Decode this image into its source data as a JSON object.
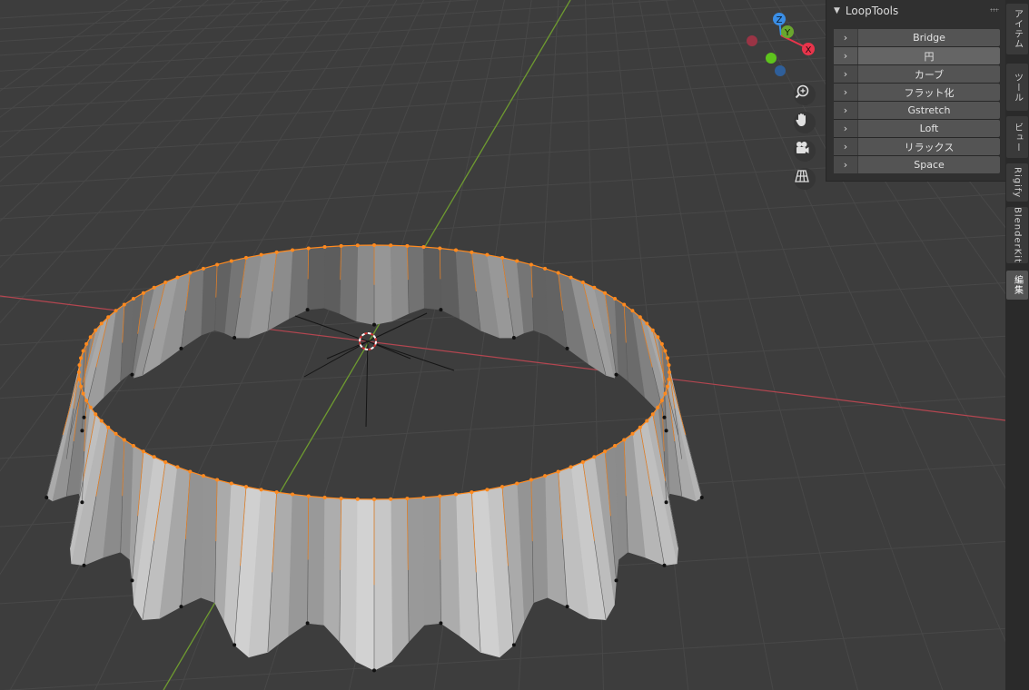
{
  "panel": {
    "title": "LoopTools",
    "operators": [
      {
        "label": "Bridge"
      },
      {
        "label": "円"
      },
      {
        "label": "カーブ"
      },
      {
        "label": "フラット化"
      },
      {
        "label": "Gstretch"
      },
      {
        "label": "Loft"
      },
      {
        "label": "リラックス"
      },
      {
        "label": "Space"
      }
    ],
    "hovered_index": 1
  },
  "tabs": [
    {
      "label": "アイテム"
    },
    {
      "label": "ツール"
    },
    {
      "label": "ビュー"
    },
    {
      "label": "Rigify"
    },
    {
      "label": "BlenderKit"
    },
    {
      "label": "編集"
    }
  ],
  "active_tab_index": 5,
  "gizmo": {
    "axis_z": "Z",
    "axis_y": "Y",
    "axis_x": "X",
    "colors": {
      "x": "#e8344b",
      "y": "#6aa62e",
      "z": "#3a8ee6"
    }
  },
  "nav_tools": [
    {
      "icon": "zoom-icon"
    },
    {
      "icon": "pan-hand-icon"
    },
    {
      "icon": "camera-icon"
    },
    {
      "icon": "perspective-grid-icon"
    }
  ],
  "colors": {
    "background": "#3d3d3d",
    "grid": "#484848",
    "x_axis": "#b34650",
    "y_axis": "#6e9a30",
    "selected_vertex": "#ff8a1f",
    "mesh": "#b8b8b8"
  }
}
